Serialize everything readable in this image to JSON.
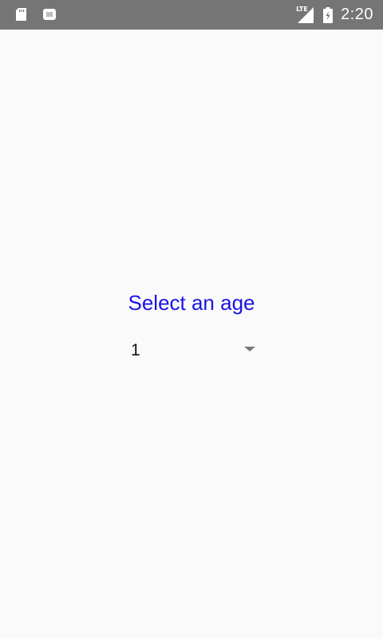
{
  "status_bar": {
    "time": "2:20",
    "network_label": "LTE",
    "icons": [
      "sd-card-icon",
      "notification-icon",
      "signal-icon",
      "battery-charging-icon"
    ]
  },
  "main": {
    "title": "Select an age",
    "title_color": "#1a14e6",
    "spinner": {
      "selected_value": "1"
    }
  }
}
